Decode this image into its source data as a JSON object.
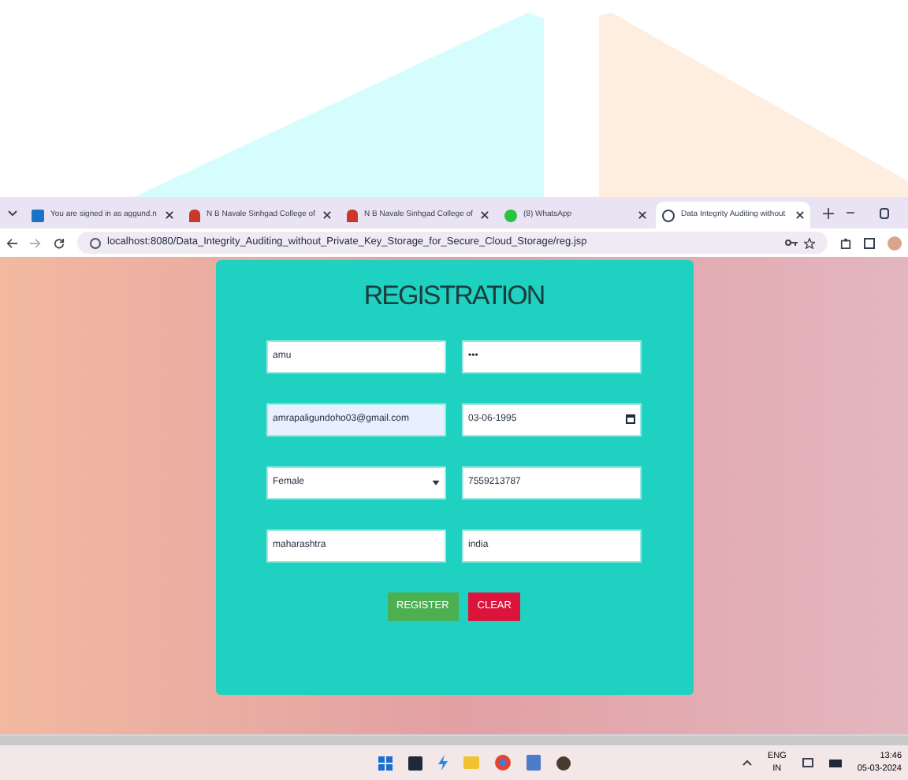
{
  "browser": {
    "tabs": [
      {
        "title": "You are signed in as aggund.n",
        "selected": false
      },
      {
        "title": "N B Navale Sinhgad College of",
        "selected": false
      },
      {
        "title": "N B Navale Sinhgad College of",
        "selected": false
      },
      {
        "title": "(8) WhatsApp",
        "selected": false
      },
      {
        "title": "Data Integrity Auditing without",
        "selected": true
      }
    ],
    "address": "localhost:8080/Data_Integrity_Auditing_without_Private_Key_Storage_for_Secure_Cloud_Storage/reg.jsp"
  },
  "form": {
    "title": "REGISTRATION",
    "fields": [
      {
        "kind": "text",
        "value": "amu",
        "autofilled": false
      },
      {
        "kind": "password",
        "value": "•••",
        "autofilled": false
      },
      {
        "kind": "text",
        "value": "amrapaligundoho03@gmail.com",
        "autofilled": true
      },
      {
        "kind": "date",
        "value": "03-06-1995",
        "autofilled": false
      },
      {
        "kind": "select",
        "value": "Female",
        "autofilled": false
      },
      {
        "kind": "text",
        "value": "7559213787",
        "autofilled": false
      },
      {
        "kind": "text",
        "value": "maharashtra",
        "autofilled": false
      },
      {
        "kind": "text",
        "value": "india",
        "autofilled": false
      }
    ],
    "buttons": [
      {
        "label": "REGISTER",
        "kind": "submit"
      },
      {
        "label": "CLEAR",
        "kind": "reset"
      }
    ]
  },
  "taskbar": {
    "language": "ENG",
    "region": "IN",
    "time": "13:46",
    "date": "05-03-2024"
  }
}
